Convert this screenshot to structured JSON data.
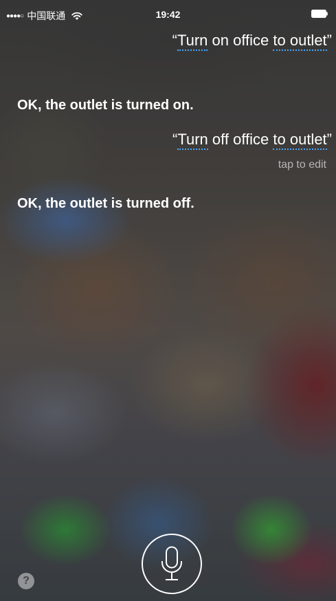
{
  "status_bar": {
    "signal": "●●●●○",
    "carrier": "中国联通",
    "time": "19:42"
  },
  "conversation": {
    "user_1": {
      "open_quote": "“",
      "word_a": "Turn",
      "middle": " on office ",
      "word_b": "to outlet",
      "close_quote": "”"
    },
    "siri_1": "OK, the outlet is turned on.",
    "user_2": {
      "open_quote": "“",
      "word_a": "Turn",
      "middle": " off office ",
      "word_b": "to outlet",
      "close_quote": "”"
    },
    "tap_to_edit": "tap to edit",
    "siri_2": "OK, the outlet is turned off."
  },
  "controls": {
    "help_label": "?"
  },
  "icons": {
    "wifi": "wifi-icon",
    "battery": "battery-icon",
    "microphone": "microphone-icon",
    "help": "help-icon"
  },
  "colors": {
    "text": "#ffffff",
    "underline": "#4aa8ff"
  }
}
